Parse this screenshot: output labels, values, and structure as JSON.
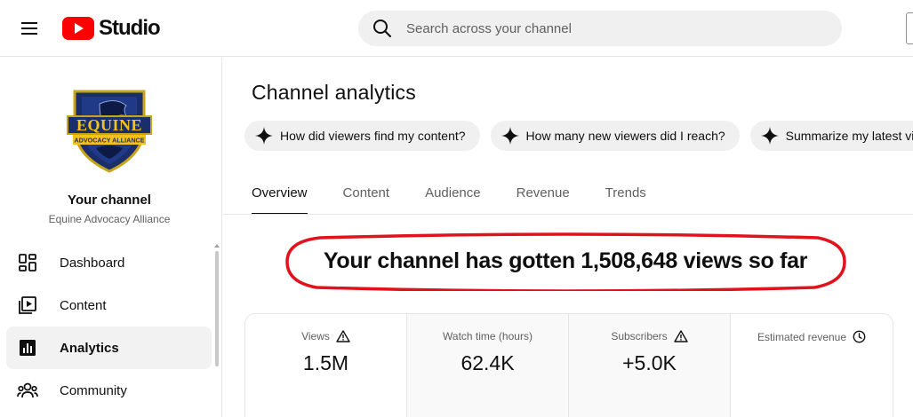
{
  "header": {
    "logo_text": "Studio",
    "search_placeholder": "Search across your channel"
  },
  "sidebar": {
    "channel_label": "Your channel",
    "channel_name": "Equine Advocacy Alliance",
    "avatar_text_top": "EQUINE",
    "avatar_text_bottom": "ADVOCACY ALLIANCE",
    "items": [
      {
        "label": "Dashboard",
        "icon": "dashboard-icon",
        "active": false
      },
      {
        "label": "Content",
        "icon": "content-icon",
        "active": false
      },
      {
        "label": "Analytics",
        "icon": "analytics-icon",
        "active": true
      },
      {
        "label": "Community",
        "icon": "community-icon",
        "active": false
      }
    ]
  },
  "main": {
    "title": "Channel analytics",
    "chips": [
      "How did viewers find my content?",
      "How many new viewers did I reach?",
      "Summarize my latest video"
    ],
    "tabs": [
      {
        "label": "Overview",
        "active": true
      },
      {
        "label": "Content",
        "active": false
      },
      {
        "label": "Audience",
        "active": false
      },
      {
        "label": "Revenue",
        "active": false
      },
      {
        "label": "Trends",
        "active": false
      }
    ],
    "headline": "Your channel has gotten 1,508,648 views so far",
    "metrics": [
      {
        "label": "Views",
        "value": "1.5M",
        "badge": "warning-icon"
      },
      {
        "label": "Watch time (hours)",
        "value": "62.4K",
        "badge": ""
      },
      {
        "label": "Subscribers",
        "value": "+5.0K",
        "badge": "warning-icon"
      },
      {
        "label": "Estimated revenue",
        "value": "",
        "badge": "clock-icon"
      }
    ]
  },
  "colors": {
    "brand_red": "#ff0000",
    "annotation_red": "#e0121b",
    "text_primary": "#0f0f0f",
    "text_secondary": "#606060",
    "shield_navy": "#1a2e6b",
    "shield_gold": "#f4c21a"
  }
}
